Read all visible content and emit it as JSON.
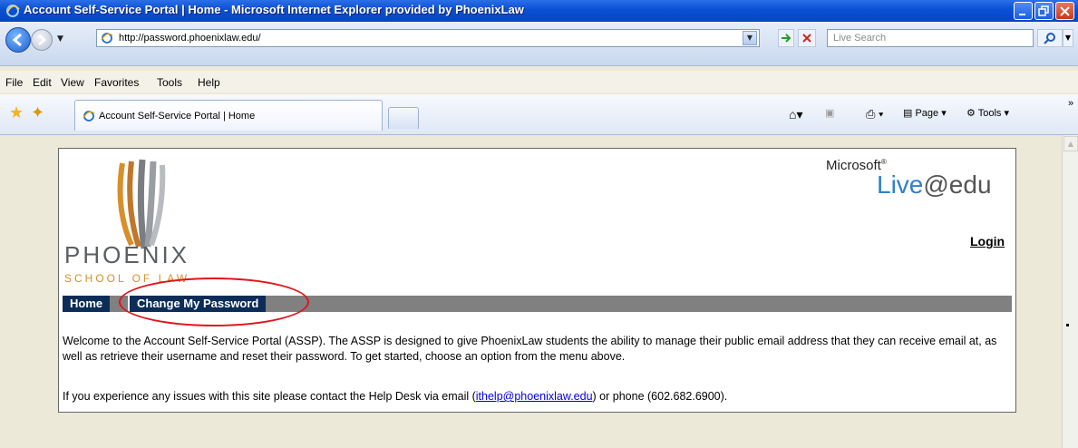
{
  "window": {
    "title": "Account Self-Service Portal | Home - Microsoft Internet Explorer provided by PhoenixLaw"
  },
  "addressbar": {
    "url": "http://password.phoenixlaw.edu/",
    "search_placeholder": "Live Search"
  },
  "menubar": {
    "items": [
      "File",
      "Edit",
      "View",
      "Favorites",
      "Tools",
      "Help"
    ]
  },
  "tabs": {
    "active_label": "Account Self-Service Portal | Home"
  },
  "commandbar": {
    "page_label": "Page",
    "tools_label": "Tools"
  },
  "site": {
    "logo_name": "PHOENIX",
    "logo_sub": "SCHOOL OF LAW",
    "ms_brand": "Microsoft",
    "live_brand": "Live",
    "edu_brand": "@edu",
    "login_label": "Login",
    "nav": {
      "home": "Home",
      "change_password": "Change My Password"
    },
    "welcome_text": "Welcome to the Account Self-Service Portal (ASSP). The ASSP is designed to give PhoenixLaw students the ability to manage their public email address that they can receive email at, as well as retrieve their username and reset their password. To get started, choose an option from the menu above.",
    "help_prefix": "If you experience any issues with this site please contact the Help Desk via email (",
    "help_email": "ithelp@phoenixlaw.edu",
    "help_suffix": ") or phone (602.682.6900)."
  },
  "colors": {
    "nav_bg": "#0b2d57",
    "nav_strip": "#808080",
    "highlight_circle": "#e0141a",
    "logo_orange": "#d88f2a",
    "live_blue": "#2f7fd0"
  }
}
